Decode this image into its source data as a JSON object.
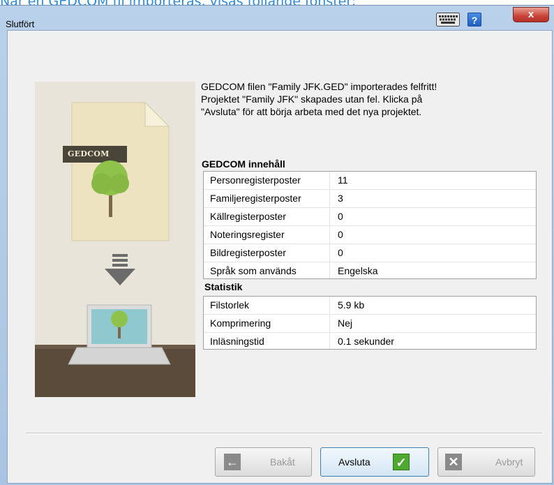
{
  "caption": "När en GEDCOM fil importeras, visas följande fönster:",
  "window": {
    "title": "Slutfört",
    "help_label": "?",
    "close_label": "x"
  },
  "illustration": {
    "badge": "GEDCOM"
  },
  "message": "GEDCOM filen \"Family JFK.GED\" importerades felfritt!\nProjektet \"Family JFK\" skapades utan fel. Klicka på\n\"Avsluta\" för att börja arbeta med det nya projektet.",
  "contents": {
    "title": "GEDCOM innehåll",
    "rows": [
      {
        "key": "Personregisterposter",
        "value": "11"
      },
      {
        "key": "Familjeregisterposter",
        "value": "3"
      },
      {
        "key": "Källregisterposter",
        "value": "0"
      },
      {
        "key": "Noteringsregister",
        "value": "0"
      },
      {
        "key": "Bildregisterposter",
        "value": "0"
      },
      {
        "key": "Språk som används",
        "value": "Engelska"
      }
    ]
  },
  "stats": {
    "title": "Statistik",
    "rows": [
      {
        "key": "Filstorlek",
        "value": "5.9 kb"
      },
      {
        "key": "Komprimering",
        "value": "Nej"
      },
      {
        "key": "Inläsningstid",
        "value": "0.1 sekunder"
      }
    ]
  },
  "buttons": {
    "back": "Bakåt",
    "finish": "Avsluta",
    "cancel": "Avbryt"
  }
}
